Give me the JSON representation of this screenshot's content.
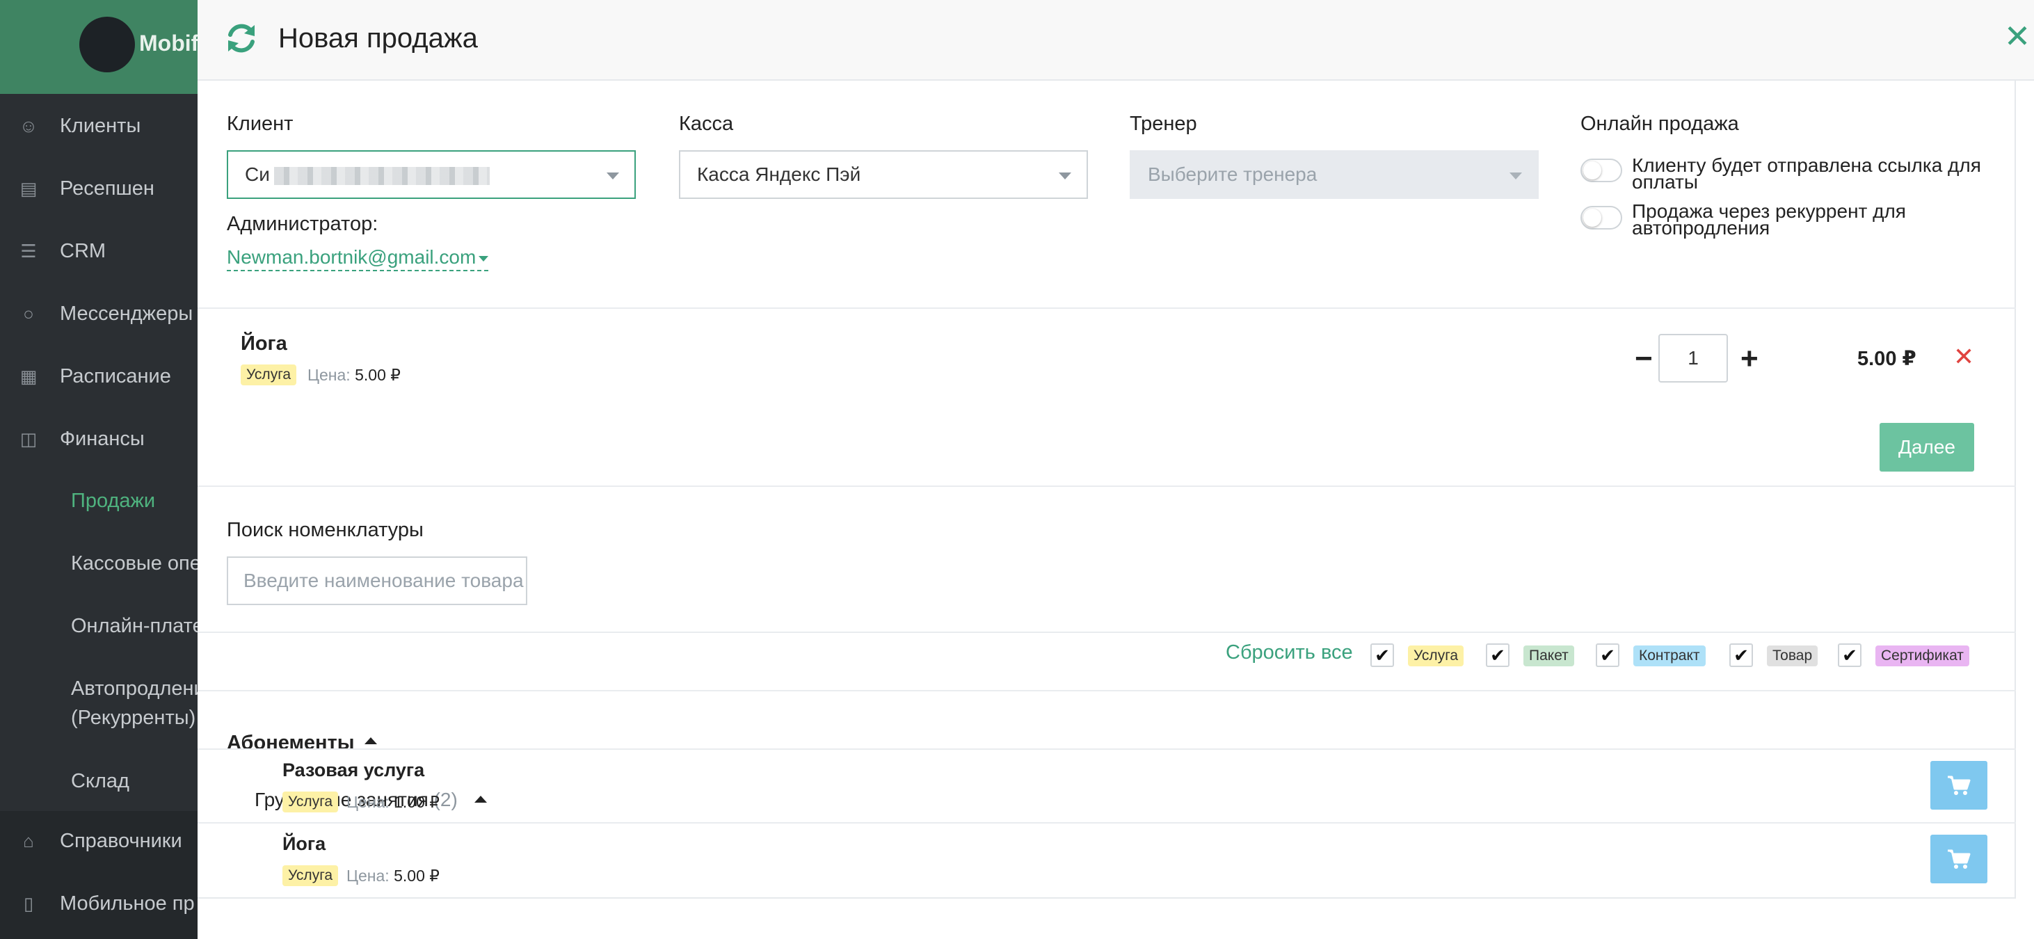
{
  "sidebar": {
    "logo_text": "Mobif",
    "items": [
      {
        "label": "Клиенты",
        "icon": "user-icon"
      },
      {
        "label": "Ресепшен",
        "icon": "clipboard-icon"
      },
      {
        "label": "CRM",
        "icon": "list-icon"
      },
      {
        "label": "Мессенджеры",
        "icon": "chat-icon"
      },
      {
        "label": "Расписание",
        "icon": "calendar-icon"
      },
      {
        "label": "Финансы",
        "icon": "cart-icon"
      }
    ],
    "finance_sub": [
      "Продажи",
      "Кассовые опе",
      "Онлайн-плате",
      "Автопродлени",
      "(Рекурренты)",
      "Склад"
    ],
    "bottom_items": [
      {
        "label": "Справочники",
        "icon": "home-icon"
      },
      {
        "label": "Мобильное пр",
        "icon": "mobile-icon"
      }
    ]
  },
  "modal": {
    "title": "Новая продажа",
    "client": {
      "label": "Клиент",
      "value_prefix": "Си"
    },
    "kassa": {
      "label": "Касса",
      "value": "Касса Яндекс Пэй"
    },
    "trainer": {
      "label": "Тренер",
      "placeholder": "Выберите тренера"
    },
    "online": {
      "label": "Онлайн продажа",
      "toggle1": "Клиенту будет отправлена ссылка для оплаты",
      "toggle2": "Продажа через рекуррент для автопродления"
    },
    "admin": {
      "label": "Администратор:",
      "value": "Newman.bortnik@gmail.com"
    },
    "cart_item": {
      "name": "Йога",
      "type": "Услуга",
      "price_label": "Цена:",
      "price": "5.00 ₽",
      "qty": "1",
      "total": "5.00 ₽"
    },
    "next_button": "Далее",
    "search": {
      "label": "Поиск номенклатуры",
      "placeholder": "Введите наименование товара"
    },
    "filters": {
      "reset": "Сбросить все",
      "types": [
        "Услуга",
        "Пакет",
        "Контракт",
        "Товар",
        "Сертификат"
      ]
    },
    "catalog": {
      "group": "Абонементы",
      "subgroup": "Групповые занятия",
      "subgroup_count": "(2)",
      "items": [
        {
          "name": "Разовая услуга",
          "type": "Услуга",
          "price_label": "Цена:",
          "price": "1.00 ₽"
        },
        {
          "name": "Йога",
          "type": "Услуга",
          "price_label": "Цена:",
          "price": "5.00 ₽"
        }
      ]
    }
  },
  "colors": {
    "accent": "#3aa17d",
    "sidebar_bg": "#2b2f33",
    "sidebar_header": "#3f8462",
    "next_button": "#6cc3a0",
    "cart_button": "#7fc8ef",
    "remove": "#e0433f"
  }
}
